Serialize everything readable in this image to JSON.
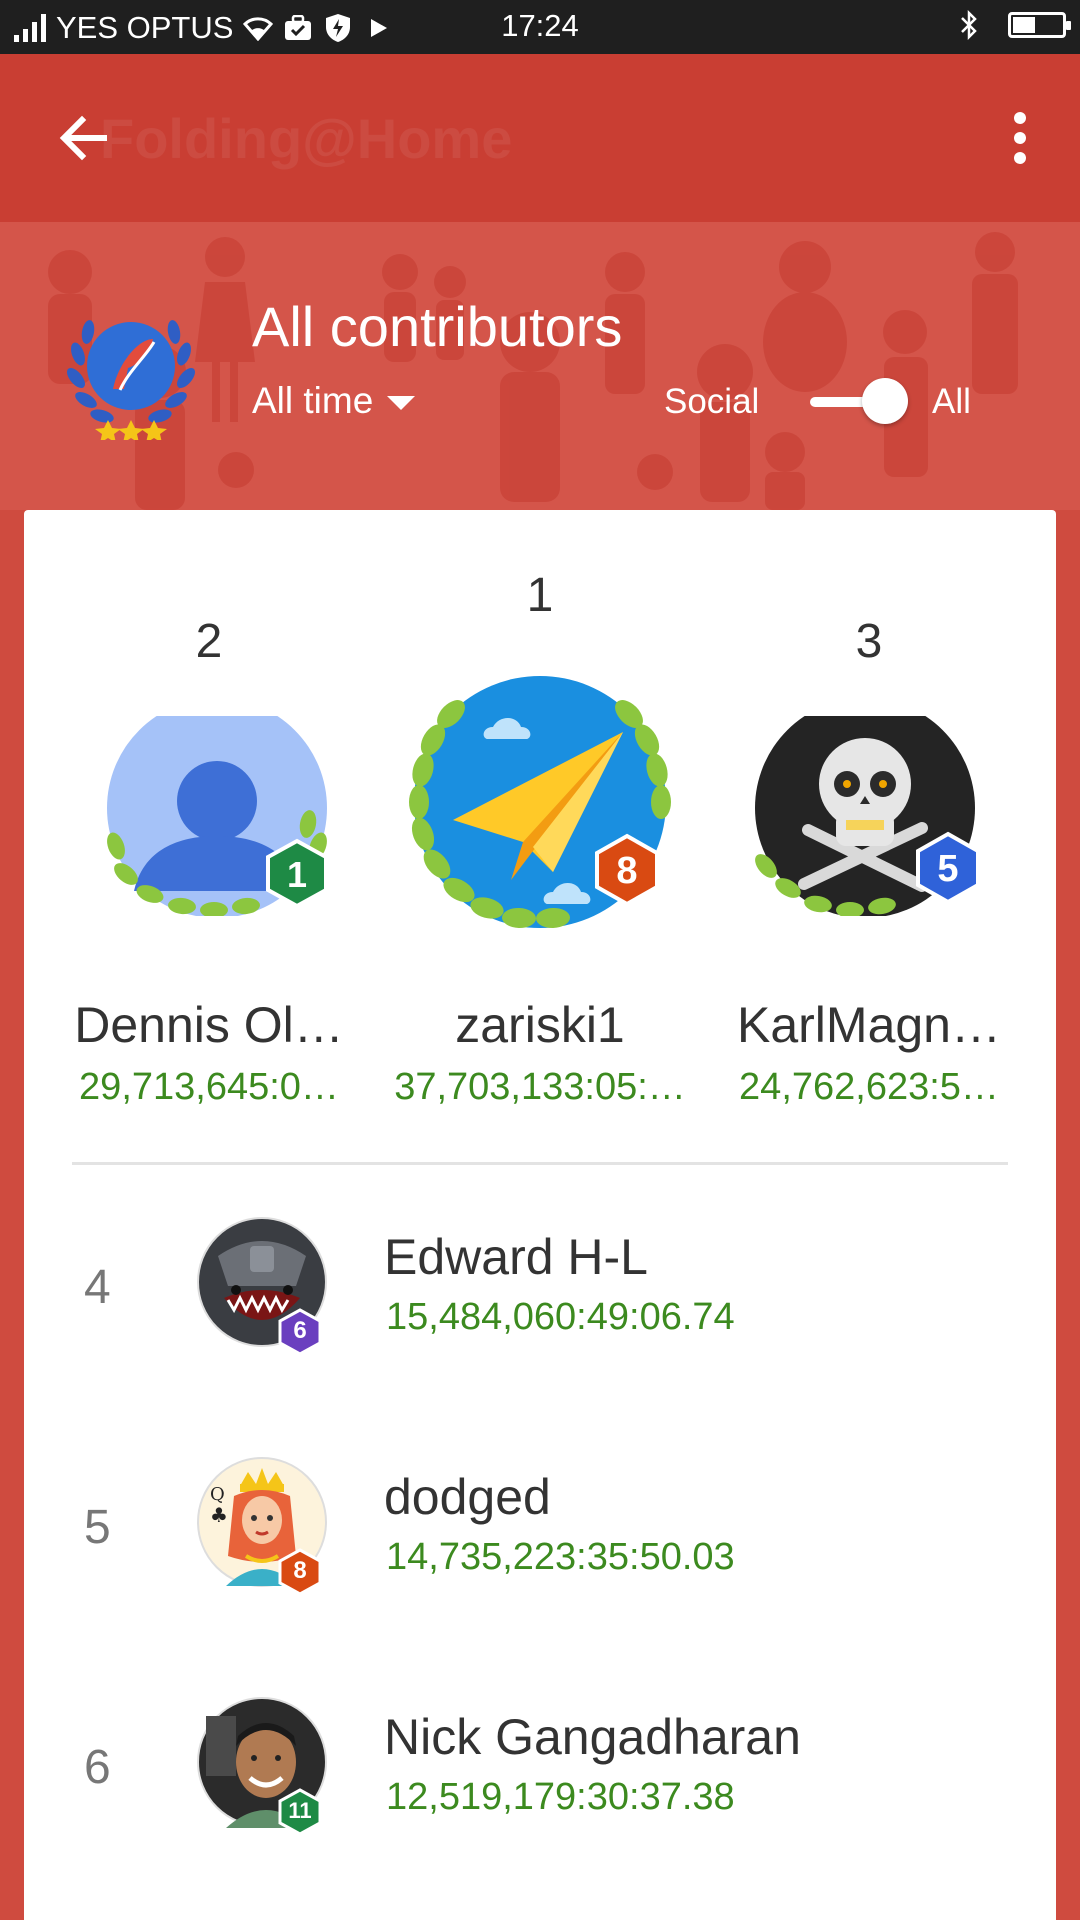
{
  "status_bar": {
    "carrier": "YES OPTUS",
    "time": "17:24",
    "battery_level": 0.45
  },
  "app_bar": {
    "ghost_title": "Folding@Home",
    "back_icon": "arrow-back-icon",
    "menu_icon": "more-vert-icon"
  },
  "header": {
    "title": "All contributors",
    "period": "All time",
    "toggle_left_label": "Social",
    "toggle_right_label": "All",
    "toggle_state": "All"
  },
  "podium": [
    {
      "rank": "2",
      "name": "Dennis Ol…",
      "score": "29,713,645:0…",
      "badge": "1",
      "badge_color": "#1e8a45"
    },
    {
      "rank": "1",
      "name": "zariski1",
      "score": "37,703,133:05:…",
      "badge": "8",
      "badge_color": "#d94a12"
    },
    {
      "rank": "3",
      "name": "KarlMagn…",
      "score": "24,762,623:5…",
      "badge": "5",
      "badge_color": "#2f62d9"
    }
  ],
  "leaderboard": [
    {
      "rank": "4",
      "name": "Edward H-L",
      "score": "15,484,060:49:06.74",
      "badge": "6",
      "badge_color": "#6a3fbf"
    },
    {
      "rank": "5",
      "name": "dodged",
      "score": "14,735,223:35:50.03",
      "badge": "8",
      "badge_color": "#d94a12"
    },
    {
      "rank": "6",
      "name": "Nick Gangadharan",
      "score": "12,519,179:30:37.38",
      "badge": "11",
      "badge_color": "#1e8a45"
    }
  ],
  "colors": {
    "app_bar": "#c93e33",
    "background": "#cf4b3f",
    "score_green": "#3c8a1f"
  }
}
